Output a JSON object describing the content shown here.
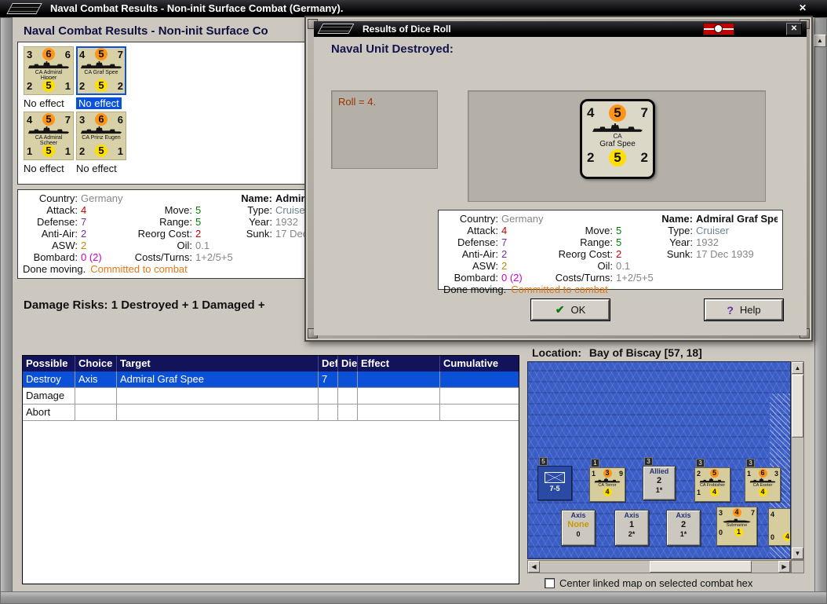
{
  "icons": {
    "up_arrow": "▲",
    "down_arrow": "▼",
    "left_arrow": "◀",
    "right_arrow": "▶",
    "close": "✕",
    "check": "✔",
    "help_mark": "?"
  },
  "window": {
    "title": "Naval Combat Results - Non-init Surface Combat (Germany).",
    "inner_title": "Naval Combat Results - Non-init Surface Co"
  },
  "unit_grid": {
    "units": [
      {
        "name": "CA Admiral Hipper",
        "top": [
          "3",
          "6",
          "6"
        ],
        "bottom": [
          "2",
          "5",
          "1"
        ],
        "status": "No effect"
      },
      {
        "name": "CA Graf Spee",
        "top": [
          "4",
          "5",
          "7"
        ],
        "bottom": [
          "2",
          "5",
          "2"
        ],
        "status": "No effect"
      },
      {
        "name": "CA Admiral Scheer",
        "top": [
          "4",
          "5",
          "7"
        ],
        "bottom": [
          "1",
          "5",
          "1"
        ],
        "status": "No effect"
      },
      {
        "name": "CA Prinz Eugen",
        "top": [
          "3",
          "6",
          "6"
        ],
        "bottom": [
          "2",
          "5",
          "1"
        ],
        "status": "No effect"
      }
    ]
  },
  "unit_details": {
    "country_label": "Country:",
    "country": "Germany",
    "name_label": "Name:",
    "name": "Admiral Graf Spee",
    "attack_label": "Attack:",
    "attack": "4",
    "move_label": "Move:",
    "move": "5",
    "type_label": "Type:",
    "type": "Cruiser",
    "defense_label": "Defense:",
    "defense": "7",
    "range_label": "Range:",
    "range": "5",
    "year_label": "Year:",
    "year": "1932",
    "antiair_label": "Anti-Air:",
    "antiair": "2",
    "reorg_label": "Reorg Cost:",
    "reorg": "2",
    "sunk_label": "Sunk:",
    "sunk": "17 Dec 1939",
    "asw_label": "ASW:",
    "asw": "2",
    "oil_label": "Oil:",
    "oil": "0.1",
    "bombard_label": "Bombard:",
    "bombard": "0 (2)",
    "costs_label": "Costs/Turns:",
    "costs": "1+2/5+5",
    "done_moving": "Done moving.",
    "committed": "Committed to combat"
  },
  "damage_risks": "Damage Risks: 1 Destroyed + 1 Damaged +",
  "combat_table": {
    "headers": [
      "Possible",
      "Choice",
      "Target",
      "Def",
      "Die",
      "Effect",
      "Cumulative"
    ],
    "rows": [
      {
        "cells": [
          "Destroy",
          "Axis",
          "Admiral Graf Spee",
          "7",
          "",
          "",
          ""
        ]
      },
      {
        "cells": [
          "Damage",
          "",
          "",
          "",
          "",
          "",
          ""
        ]
      },
      {
        "cells": [
          "Abort",
          "",
          "",
          "",
          "",
          "",
          ""
        ]
      }
    ]
  },
  "location": {
    "label": "Location:",
    "value": "Bay of Biscay [57, 18]"
  },
  "map": {
    "counters": {
      "land": {
        "badge": "5",
        "strength": "7-5"
      },
      "terror": {
        "badge": "1",
        "top": [
          "1",
          "3",
          "9"
        ],
        "name": "CA Terror",
        "bottom": [
          "",
          "4",
          ""
        ]
      },
      "allied": {
        "badge": "3",
        "side": "Allied",
        "value": "2",
        "mod": "1*"
      },
      "frobisher": {
        "badge": "3",
        "top": [
          "2",
          "5",
          ""
        ],
        "name": "CA Frobisher",
        "bottom": [
          "1",
          "4",
          ""
        ]
      },
      "exeter": {
        "badge": "3",
        "top": [
          "1",
          "6",
          "3"
        ],
        "name": "CA Exeter",
        "bottom": [
          "",
          "4",
          ""
        ]
      },
      "axis_a": {
        "side": "Axis",
        "value": "None",
        "mod": "0"
      },
      "axis_b": {
        "side": "Axis",
        "value": "1",
        "mod": "2*"
      },
      "axis_c": {
        "side": "Axis",
        "value": "2",
        "mod": "1*"
      },
      "submarine": {
        "top": [
          "3",
          "4",
          "7"
        ],
        "name": "Submarine",
        "bottom": [
          "0",
          "1",
          ""
        ]
      },
      "partial": {
        "top": [
          "4",
          "",
          ""
        ],
        "bottom": [
          "0",
          "4",
          ""
        ]
      }
    }
  },
  "map_options": {
    "center_checkbox_label": "Center linked map on selected combat hex",
    "checked": false
  },
  "dialog": {
    "title": "Results of Dice Roll",
    "heading": "Naval Unit Destroyed:",
    "roll_text": "Roll = 4.",
    "counter": {
      "name_top": "CA",
      "name_bottom": "Graf Spee",
      "top": [
        "4",
        "5",
        "7"
      ],
      "bottom": [
        "2",
        "5",
        "2"
      ]
    },
    "ok_label": "OK",
    "help_label": "Help"
  }
}
